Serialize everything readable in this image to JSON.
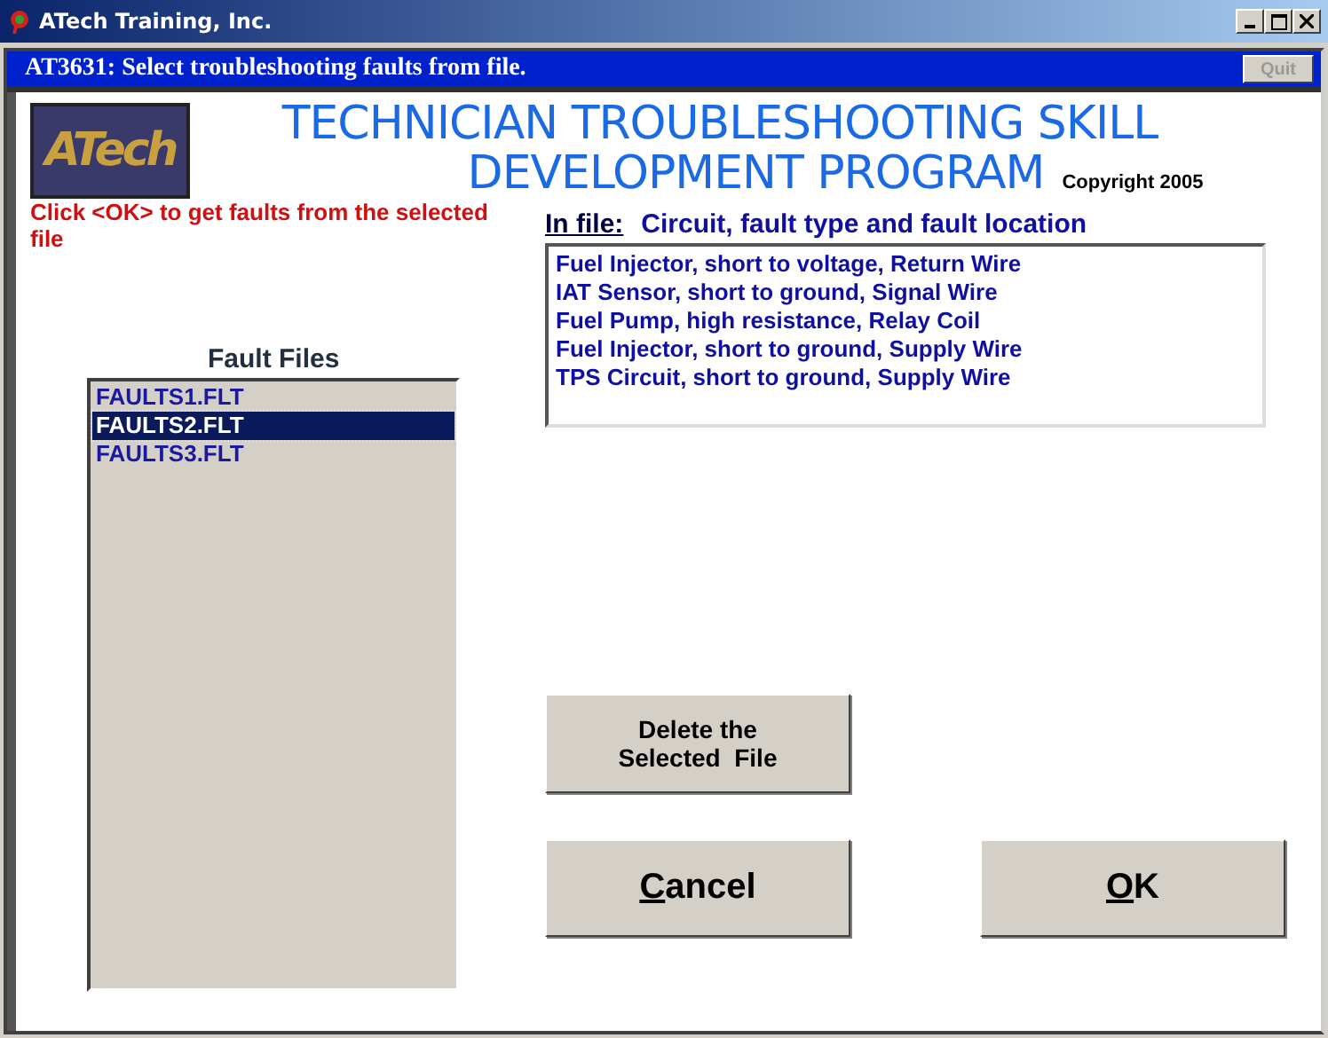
{
  "window": {
    "title": "ATech Training, Inc."
  },
  "header_bar": {
    "caption": "AT3631:  Select troubleshooting faults from  file.",
    "quit_button": {
      "label": "Quit",
      "disabled": true
    }
  },
  "logo": {
    "text": "ATech"
  },
  "program_title": [
    "TECHNICIAN TROUBLESHOOTING SKILL",
    "DEVELOPMENT PROGRAM"
  ],
  "copyright": "Copyright 2005",
  "instruction": "Click <OK> to get faults from the selected file",
  "in_file": {
    "label": "In file:",
    "heading": "Circuit, fault type and fault location",
    "faults": [
      "Fuel Injector, short to voltage, Return Wire",
      "IAT Sensor, short to ground, Signal Wire",
      "Fuel Pump, high resistance, Relay Coil",
      "Fuel Injector, short to ground, Supply Wire",
      "TPS Circuit, short to ground, Supply Wire"
    ]
  },
  "fault_files": {
    "label": "Fault Files",
    "items": [
      {
        "name": "FAULTS1.FLT",
        "selected": false
      },
      {
        "name": "FAULTS2.FLT",
        "selected": true
      },
      {
        "name": "FAULTS3.FLT",
        "selected": false
      }
    ]
  },
  "buttons": [
    {
      "kind": "small",
      "label": "Delete the Selected  File",
      "underline_first": false
    },
    {
      "kind": "large",
      "label": "Cancel",
      "underline_first": true
    },
    {
      "kind": "large",
      "label": "OK",
      "underline_first": true
    }
  ]
}
